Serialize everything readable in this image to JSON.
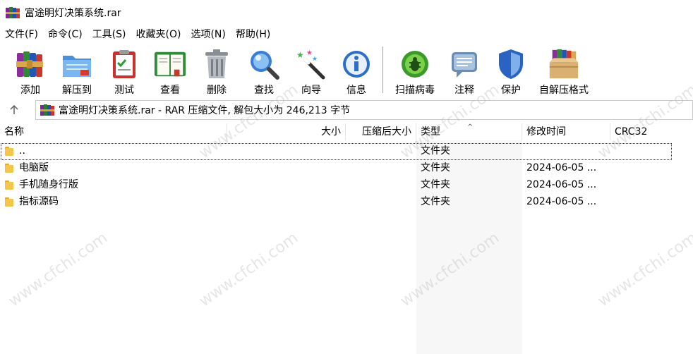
{
  "window": {
    "title": "富途明灯决策系统.rar"
  },
  "menu": [
    {
      "label": "文件(F)"
    },
    {
      "label": "命令(C)"
    },
    {
      "label": "工具(S)"
    },
    {
      "label": "收藏夹(O)"
    },
    {
      "label": "选项(N)"
    },
    {
      "label": "帮助(H)"
    }
  ],
  "toolbar": {
    "add": {
      "label": "添加",
      "icon": "books-add-icon"
    },
    "extract": {
      "label": "解压到",
      "icon": "folder-extract-icon"
    },
    "test": {
      "label": "测试",
      "icon": "clipboard-check-icon"
    },
    "view": {
      "label": "查看",
      "icon": "open-book-icon"
    },
    "delete": {
      "label": "删除",
      "icon": "trash-can-icon"
    },
    "find": {
      "label": "查找",
      "icon": "magnifier-icon"
    },
    "wizard": {
      "label": "向导",
      "icon": "magic-wand-icon"
    },
    "info": {
      "label": "信息",
      "icon": "info-icon"
    },
    "scan": {
      "label": "扫描病毒",
      "icon": "virus-scan-icon"
    },
    "comment": {
      "label": "注释",
      "icon": "comment-icon"
    },
    "protect": {
      "label": "保护",
      "icon": "shield-icon"
    },
    "sfx": {
      "label": "自解压格式",
      "icon": "box-books-icon"
    }
  },
  "address": {
    "text": "富途明灯决策系统.rar - RAR 压缩文件, 解包大小为 246,213 字节"
  },
  "columns": {
    "name": "名称",
    "size": "大小",
    "packed": "压缩后大小",
    "type": "类型",
    "mtime": "修改时间",
    "crc": "CRC32"
  },
  "files": [
    {
      "name": "..",
      "type": "文件夹",
      "mtime": ""
    },
    {
      "name": "电脑版",
      "type": "文件夹",
      "mtime": "2024-06-05 ..."
    },
    {
      "name": "手机随身行版",
      "type": "文件夹",
      "mtime": "2024-06-05 ..."
    },
    {
      "name": "指标源码",
      "type": "文件夹",
      "mtime": "2024-06-05 ..."
    }
  ],
  "watermark": "www.cfchi.com",
  "colors": {
    "type_column_bg": "#f7f7f7",
    "folder": "#f2c54b"
  }
}
